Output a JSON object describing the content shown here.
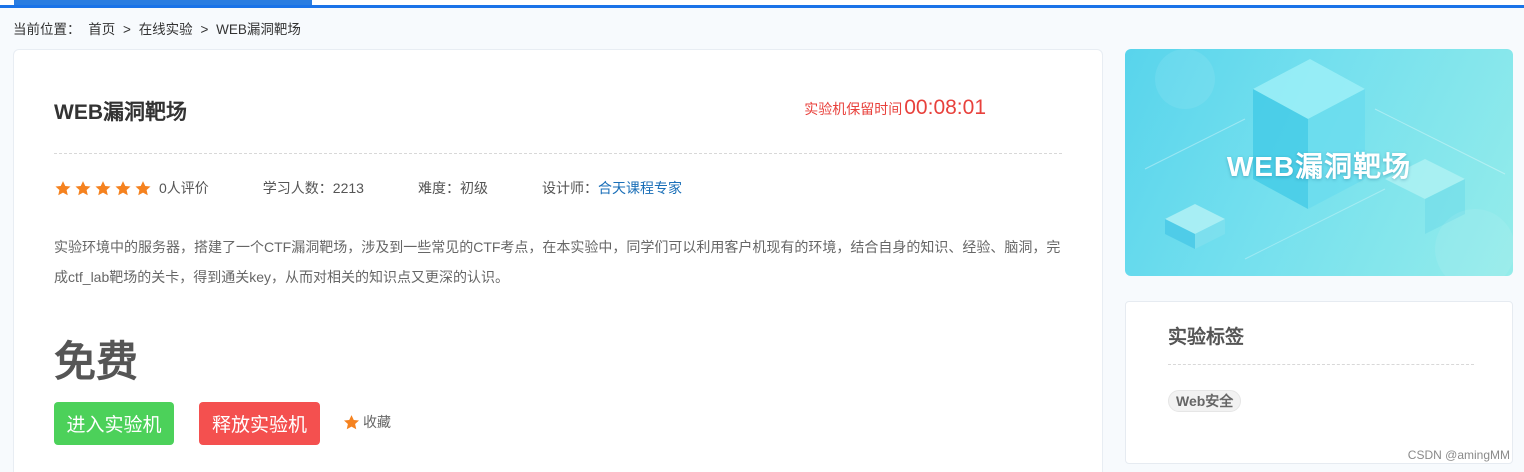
{
  "breadcrumb": {
    "label": "当前位置：",
    "items": [
      "首页",
      "在线实验",
      "WEB漏洞靶场"
    ],
    "separator": ">"
  },
  "lab": {
    "title": "WEB漏洞靶场",
    "timer_label": "实验机保留时间",
    "timer_value": "00:08:01",
    "rating_stars": 5,
    "rating_count": "0人评价",
    "learners": "学习人数：2213",
    "difficulty": "难度：初级",
    "designer_label": "设计师：",
    "designer_name": "合天课程专家",
    "description": "实验环境中的服务器，搭建了一个CTF漏洞靶场，涉及到一些常见的CTF考点，在本实验中，同学们可以利用客户机现有的环境，结合自身的知识、经验、脑洞，完成ctf_lab靶场的关卡，得到通关key，从而对相关的知识点又更深的认识。",
    "price": "免费",
    "enter_button": "进入实验机",
    "release_button": "释放实验机",
    "favorite_label": "收藏"
  },
  "banner": {
    "title": "WEB漏洞靶场"
  },
  "tags": {
    "title": "实验标签",
    "items": [
      "Web安全"
    ]
  },
  "watermark": "CSDN @amingMM",
  "colors": {
    "accent_blue": "#1a73e8",
    "timer_red": "#e8413c",
    "star_orange": "#f5821f",
    "enter_green": "#4cd15a",
    "release_red": "#f4504f",
    "link_blue": "#1a6fb8"
  },
  "icons": {
    "rating": "star-icon",
    "favorite": "star-icon"
  }
}
